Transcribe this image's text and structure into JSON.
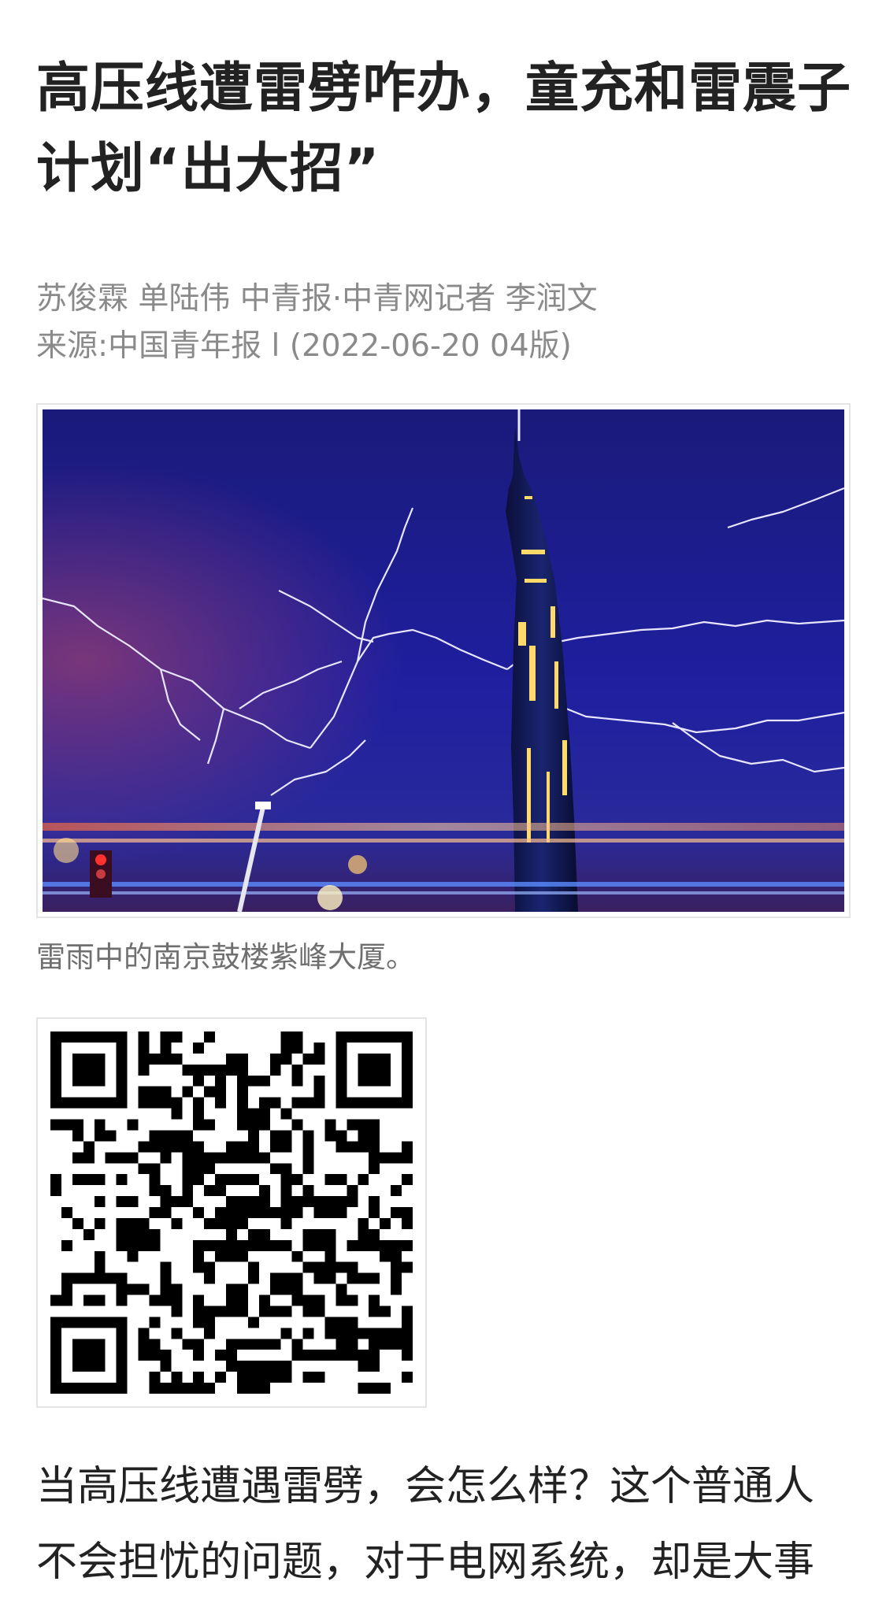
{
  "article": {
    "title": "高压线遭雷劈咋办，童充和雷震子计划“出大招”",
    "byline": "苏俊霖 单陆伟 中青报·中青网记者 李润文",
    "source": "来源:中国青年报 l (2022-06-20  04版)",
    "image": {
      "icon": "lightning-tower-photo",
      "caption": "雷雨中的南京鼓楼紫峰大厦。"
    },
    "qr": {
      "icon": "qr-code"
    },
    "paragraph": "当高压线遭遇雷劈，会怎么样？这个普通人不会担忧的问题，对于电网系统，却是大事"
  }
}
